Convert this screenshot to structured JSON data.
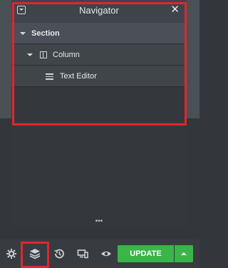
{
  "navigator": {
    "title": "Navigator",
    "close_glyph": "✕",
    "resize_glyph": "•••",
    "tree": [
      {
        "label": "Section",
        "level": 0
      },
      {
        "label": "Column",
        "level": 1
      },
      {
        "label": "Text Editor",
        "level": 2
      }
    ]
  },
  "footer": {
    "icons": [
      "gear-icon",
      "layers-icon",
      "history-icon",
      "responsive-icon",
      "eye-icon"
    ],
    "update_label": "UPDATE"
  },
  "colors": {
    "panel_dark": "#34383c",
    "accent_green": "#39b54a",
    "highlight_red": "#e0262f"
  }
}
